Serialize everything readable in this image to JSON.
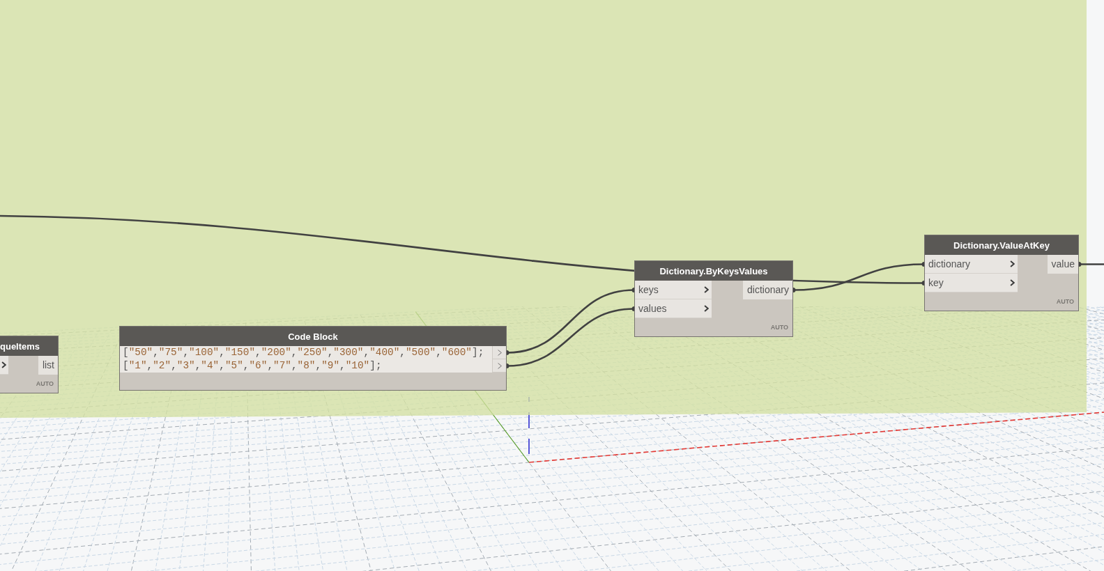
{
  "canvas": {
    "nodes": [
      {
        "kind": "function",
        "title": "queItems",
        "inputs": [
          {
            "kind": "chevron_only"
          }
        ],
        "outputs": [
          "list"
        ],
        "lacing": "AUTO"
      },
      {
        "kind": "code_block",
        "title": "Code Block",
        "code_lines": [
          "[\"50\",\"75\",\"100\",\"150\",\"200\",\"250\",\"300\",\"400\",\"500\",\"600\"];",
          "[\"1\",\"2\",\"3\",\"4\",\"5\",\"6\",\"7\",\"8\",\"9\",\"10\"];"
        ]
      },
      {
        "kind": "function",
        "title": "Dictionary.ByKeysValues",
        "inputs": [
          {
            "kind": "labeled",
            "label": "keys"
          },
          {
            "kind": "labeled",
            "label": "values"
          }
        ],
        "outputs": [
          "dictionary"
        ],
        "lacing": "AUTO"
      },
      {
        "kind": "function",
        "title": "Dictionary.ValueAtKey",
        "inputs": [
          {
            "kind": "labeled",
            "label": "dictionary"
          },
          {
            "kind": "labeled",
            "label": "key"
          }
        ],
        "outputs": [
          "value"
        ],
        "lacing": "AUTO"
      }
    ]
  }
}
